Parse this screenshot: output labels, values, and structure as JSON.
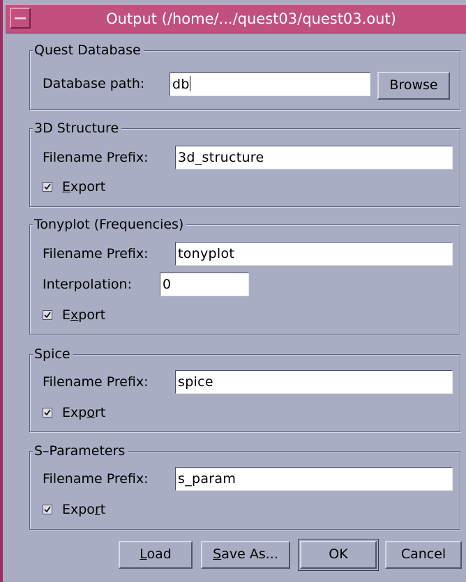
{
  "window": {
    "title": "Output (/home/.../quest03/quest03.out)"
  },
  "quest_db": {
    "legend": "Quest Database",
    "path_label": "Database path:",
    "path_value": "db",
    "browse_label": "Browse"
  },
  "structure": {
    "legend": "3D Structure",
    "prefix_label": "Filename Prefix:",
    "prefix_value": "3d_structure",
    "export_checked": true,
    "export_label_pre": "",
    "export_label_mn": "E",
    "export_label_post": "xport"
  },
  "tonyplot": {
    "legend": "Tonyplot (Frequencies)",
    "prefix_label": "Filename Prefix:",
    "prefix_value": "tonyplot",
    "interp_label": "Interpolation:",
    "interp_value": "0",
    "export_checked": true,
    "export_label_pre": "E",
    "export_label_mn": "x",
    "export_label_post": "port"
  },
  "spice": {
    "legend": "Spice",
    "prefix_label": "Filename Prefix:",
    "prefix_value": "spice",
    "export_checked": true,
    "export_label_pre": "Exp",
    "export_label_mn": "o",
    "export_label_post": "rt"
  },
  "sparams": {
    "legend": "S–Parameters",
    "prefix_label": "Filename Prefix:",
    "prefix_value": "s_param",
    "export_checked": true,
    "export_label_pre": "Expo",
    "export_label_mn": "r",
    "export_label_post": "t"
  },
  "buttons": {
    "load_mn": "L",
    "load_rest": "oad",
    "saveas_mn": "S",
    "saveas_rest": "ave As...",
    "ok": "OK",
    "cancel": "Cancel"
  }
}
